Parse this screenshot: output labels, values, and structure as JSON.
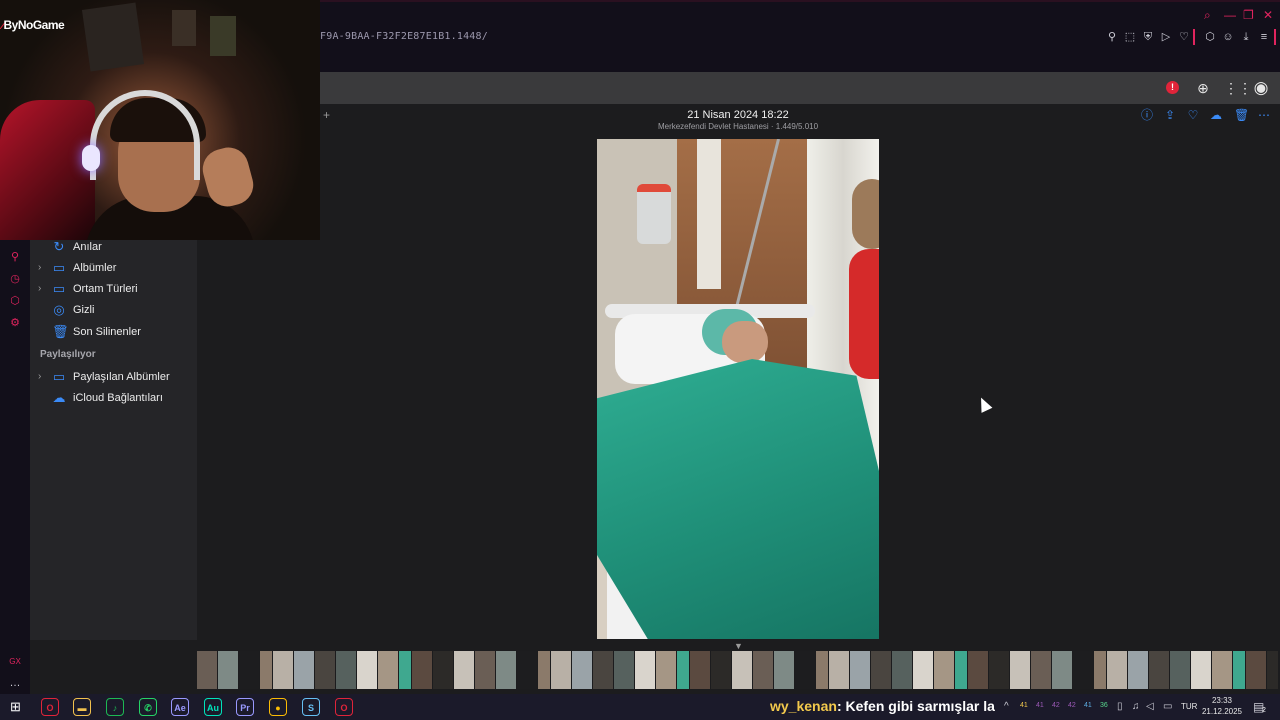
{
  "browser": {
    "url_fragment": "F9A-9BAA-F32F2E87E1B1.1448/",
    "window_controls": [
      "search-icon",
      "minimize-icon",
      "restore-icon",
      "close-icon"
    ],
    "toolbar_icons": [
      "pin-icon",
      "snapshot-icon",
      "shield-icon",
      "play-icon",
      "heart-icon",
      "extensions-icon",
      "profile-icon",
      "download-icon",
      "menu-icon"
    ]
  },
  "brand": {
    "name": "ByNoGame"
  },
  "appbar": {
    "alert_badge": "!",
    "icons": [
      "add-circle-icon",
      "apps-grid-icon",
      "account-icon"
    ]
  },
  "sidebar": {
    "items": [
      {
        "label": "Anılar",
        "icon": "memories-icon",
        "has_chevron": false
      },
      {
        "label": "Albümler",
        "icon": "albums-icon",
        "has_chevron": true
      },
      {
        "label": "Ortam Türleri",
        "icon": "media-types-icon",
        "has_chevron": true
      },
      {
        "label": "Gizli",
        "icon": "hidden-eye-icon",
        "has_chevron": false
      },
      {
        "label": "Son Silinenler",
        "icon": "trash-icon",
        "has_chevron": false
      }
    ],
    "shared_header": "Paylaşılıyor",
    "shared_items": [
      {
        "label": "Paylaşılan Albümler",
        "icon": "shared-albums-icon",
        "has_chevron": true
      },
      {
        "label": "iCloud Bağlantıları",
        "icon": "icloud-link-icon",
        "has_chevron": false
      }
    ]
  },
  "photo": {
    "date": "21 Nisan 2024 18:22",
    "location": "Merkezefendi Devlet Hastanesi · 1.449/5.010",
    "actions": [
      "info-icon",
      "share-icon",
      "favorite-icon",
      "download-cloud-icon",
      "delete-icon",
      "more-icon"
    ],
    "add_label": "+"
  },
  "taskbar": {
    "apps": [
      {
        "name": "opera-gx",
        "label": "O",
        "color": "#e0243a"
      },
      {
        "name": "file-explorer",
        "label": "▬",
        "color": "#f2c14e"
      },
      {
        "name": "spotify",
        "label": "♪",
        "color": "#1db954"
      },
      {
        "name": "whatsapp",
        "label": "✆",
        "color": "#25d366"
      },
      {
        "name": "after-effects",
        "label": "Ae",
        "color": "#9999ff"
      },
      {
        "name": "audition",
        "label": "Au",
        "color": "#00e4bb"
      },
      {
        "name": "premiere",
        "label": "Pr",
        "color": "#9999ff"
      },
      {
        "name": "chrome",
        "label": "●",
        "color": "#fbbc05"
      },
      {
        "name": "steam",
        "label": "S",
        "color": "#66c0f4"
      },
      {
        "name": "opera-gx-2",
        "label": "O",
        "color": "#e0243a"
      }
    ],
    "chat_user": "wy_kenan",
    "chat_message": ": Kefen gibi sarmışlar la",
    "tray_numbers": [
      "41",
      "41",
      "42",
      "42",
      "41",
      "36"
    ],
    "language": "TUR",
    "time": "23:33",
    "date": "21.12.2025",
    "notification_count": "2"
  },
  "gx_label": "GX"
}
